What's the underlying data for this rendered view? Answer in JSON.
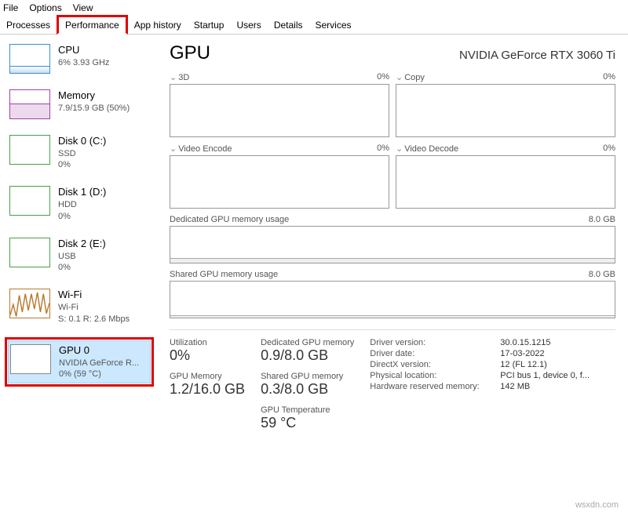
{
  "menu": {
    "file": "File",
    "options": "Options",
    "view": "View"
  },
  "tabs": {
    "processes": "Processes",
    "performance": "Performance",
    "apphistory": "App history",
    "startup": "Startup",
    "users": "Users",
    "details": "Details",
    "services": "Services"
  },
  "sidebar": {
    "cpu": {
      "title": "CPU",
      "sub": "6%  3.93 GHz"
    },
    "mem": {
      "title": "Memory",
      "sub": "7.9/15.9 GB (50%)"
    },
    "disk0": {
      "title": "Disk 0 (C:)",
      "sub1": "SSD",
      "sub2": "0%"
    },
    "disk1": {
      "title": "Disk 1 (D:)",
      "sub1": "HDD",
      "sub2": "0%"
    },
    "disk2": {
      "title": "Disk 2 (E:)",
      "sub1": "USB",
      "sub2": "0%"
    },
    "wifi": {
      "title": "Wi-Fi",
      "sub1": "Wi-Fi",
      "sub2": "S: 0.1 R: 2.6 Mbps"
    },
    "gpu": {
      "title": "GPU 0",
      "sub1": "NVIDIA GeForce R...",
      "sub2": "0%  (59 °C)"
    }
  },
  "main": {
    "title": "GPU",
    "name": "NVIDIA GeForce RTX 3060 Ti",
    "charts": {
      "c3d": {
        "label": "3D",
        "pct": "0%"
      },
      "copy": {
        "label": "Copy",
        "pct": "0%"
      },
      "venc": {
        "label": "Video Encode",
        "pct": "0%"
      },
      "vdec": {
        "label": "Video Decode",
        "pct": "0%"
      }
    },
    "dedicated": {
      "label": "Dedicated GPU memory usage",
      "max": "8.0 GB"
    },
    "shared": {
      "label": "Shared GPU memory usage",
      "max": "8.0 GB"
    },
    "stats": {
      "util": {
        "label": "Utilization",
        "value": "0%"
      },
      "gpumem": {
        "label": "GPU Memory",
        "value": "1.2/16.0 GB"
      },
      "dedmem": {
        "label": "Dedicated GPU memory",
        "value": "0.9/8.0 GB"
      },
      "shmem": {
        "label": "Shared GPU memory",
        "value": "0.3/8.0 GB"
      },
      "temp": {
        "label": "GPU Temperature",
        "value": "59 °C"
      }
    },
    "info": {
      "drvver": {
        "k": "Driver version:",
        "v": "30.0.15.1215"
      },
      "drvdate": {
        "k": "Driver date:",
        "v": "17-03-2022"
      },
      "dxver": {
        "k": "DirectX version:",
        "v": "12 (FL 12.1)"
      },
      "phys": {
        "k": "Physical location:",
        "v": "PCI bus 1, device 0, f..."
      },
      "hwres": {
        "k": "Hardware reserved memory:",
        "v": "142 MB"
      }
    }
  },
  "watermark": "wsxdn.com"
}
